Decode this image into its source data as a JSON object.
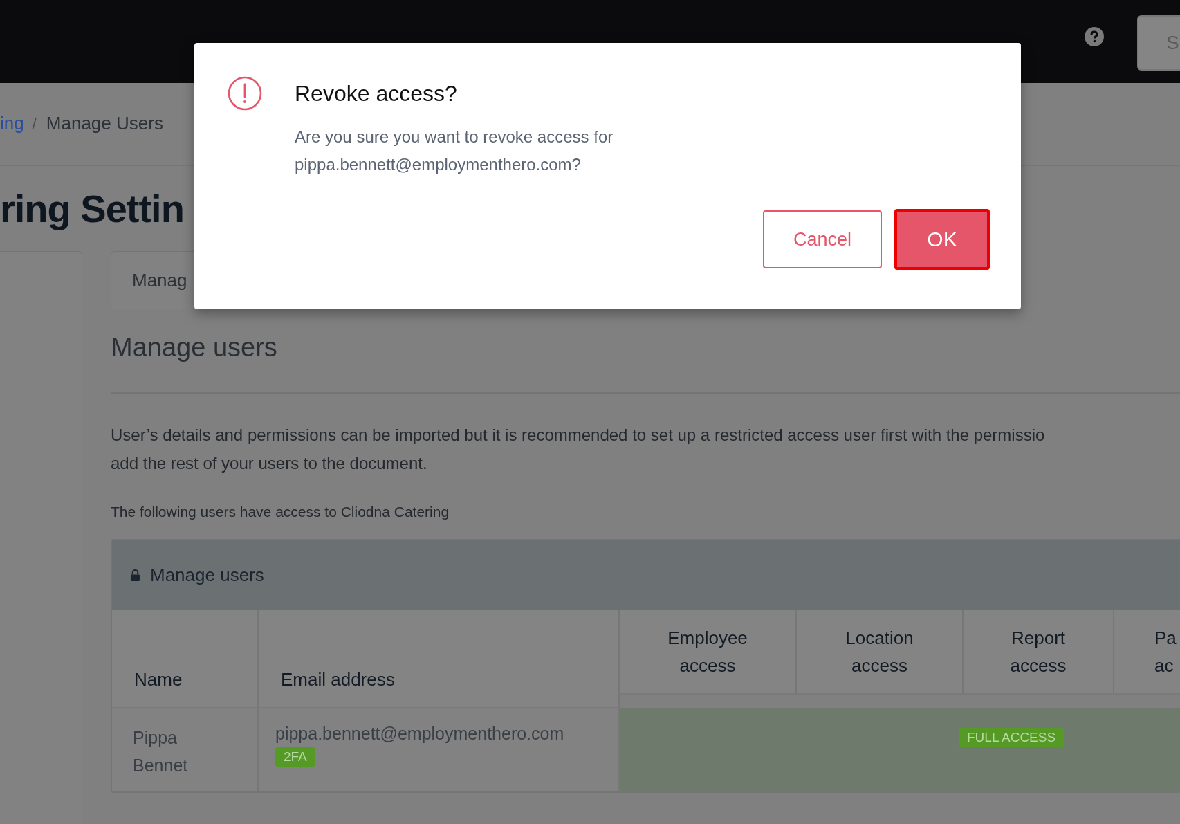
{
  "top_bar": {
    "button": {
      "label": "S"
    }
  },
  "breadcrumb": {
    "items": [
      {
        "label": "ing",
        "kind": "link"
      },
      {
        "label": "Manage Users",
        "kind": "current"
      }
    ],
    "separator": "/"
  },
  "page_title": "ring Settin",
  "tabs": [
    {
      "label": "Manag",
      "selected": true
    }
  ],
  "section": {
    "heading": "Manage users",
    "description_lines": [
      "User’s details and permissions can be imported but it is recommended to set up a restricted access user first with the permissio",
      "add the rest of your users to the document."
    ],
    "access_note": "The following users have access to Cliodna Catering",
    "panel": {
      "title": "Manage users",
      "columns": [
        "Name",
        "Email address",
        "Employee access",
        "Location access",
        "Report access",
        "Pa ac"
      ],
      "rows": [
        {
          "name": "Pippa Bennet",
          "email": "pippa.bennett@employmenthero.com",
          "badges": [
            "2FA"
          ],
          "access": "FULL ACCESS"
        }
      ]
    }
  },
  "dialog": {
    "title": "Revoke access?",
    "message": "Are you sure you want to revoke access for pippa.bennett@employmenthero.com?",
    "buttons": [
      {
        "label": "Cancel",
        "kind": "secondary",
        "focused": false
      },
      {
        "label": "OK",
        "kind": "primary",
        "focused": true
      }
    ]
  }
}
